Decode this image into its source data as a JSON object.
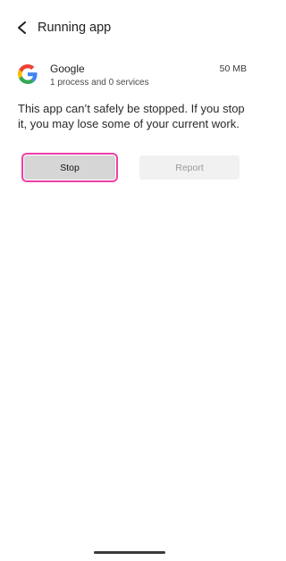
{
  "header": {
    "title": "Running app",
    "back_icon": "arrow-left-icon"
  },
  "app": {
    "name": "Google",
    "size": "50 MB",
    "processes": "1 process and 0 services",
    "icon": "google-logo-icon"
  },
  "message": "This app can’t safely be stopped. If you stop it, you may lose some of your current work.",
  "actions": {
    "stop_label": "Stop",
    "report_label": "Report",
    "highlight_color": "#ee3fa8"
  },
  "colors": {
    "google_blue": "#4285F4",
    "google_red": "#EA4335",
    "google_yellow": "#FBBC05",
    "google_green": "#34A853"
  }
}
